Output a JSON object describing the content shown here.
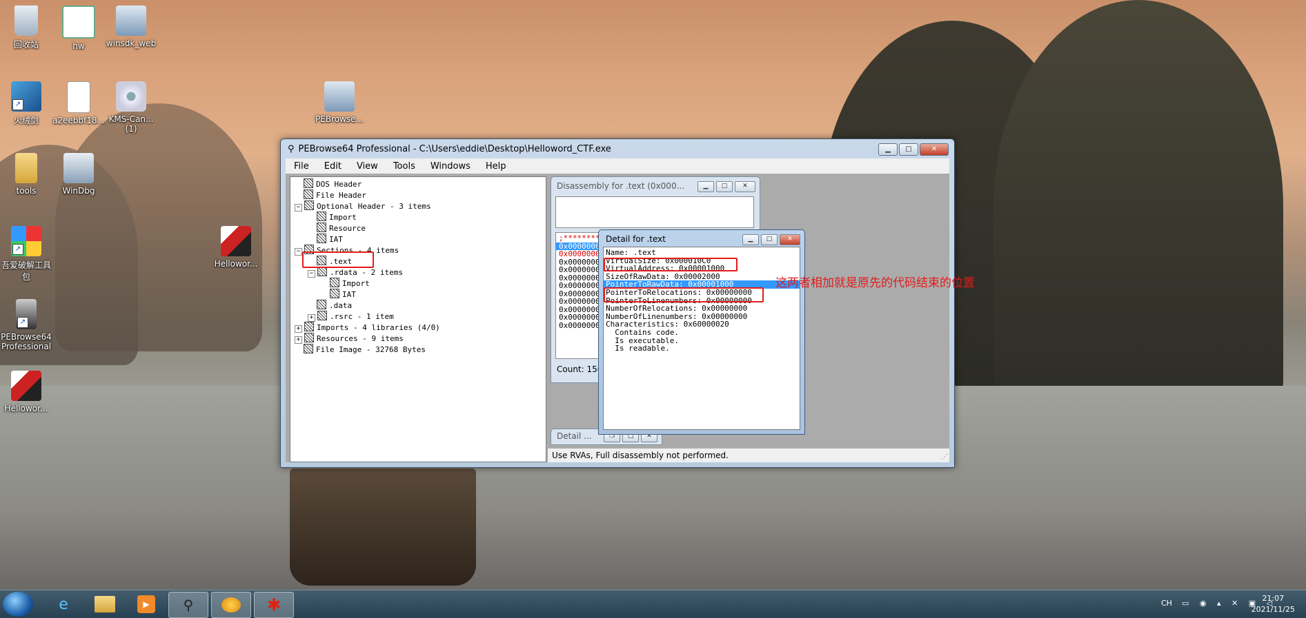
{
  "desktop": {
    "icons": [
      {
        "label": "回收站",
        "icon": "recycle-bin-icon"
      },
      {
        "label": "hw",
        "icon": "window-icon"
      },
      {
        "label": "winsdk_web",
        "icon": "installer-icon"
      },
      {
        "label": "火绒剑",
        "icon": "app-shortcut-icon"
      },
      {
        "label": "a2eebbf18...",
        "icon": "file-icon"
      },
      {
        "label": "KMS-Can... (1)",
        "icon": "gear-icon"
      },
      {
        "label": "PEBrowse...",
        "icon": "installer-icon"
      },
      {
        "label": "tools",
        "icon": "folder-icon"
      },
      {
        "label": "WinDbg",
        "icon": "debugger-icon"
      },
      {
        "label": "吾爱破解工具包",
        "icon": "toolkit-icon"
      },
      {
        "label": "Hellowor...",
        "icon": "cube-app-icon"
      },
      {
        "label": "PEBrowse64 Professional",
        "icon": "microscope-icon"
      },
      {
        "label": "Hellowor...",
        "icon": "cube-app-icon"
      }
    ]
  },
  "main_window": {
    "title": "PEBrowse64 Professional - C:\\Users\\eddie\\Desktop\\Helloword_CTF.exe",
    "menu": [
      "File",
      "Edit",
      "View",
      "Tools",
      "Windows",
      "Help"
    ],
    "tree": [
      {
        "label": "DOS Header",
        "level": 0,
        "expander": ""
      },
      {
        "label": "File Header",
        "level": 0,
        "expander": ""
      },
      {
        "label": "Optional Header - 3 items",
        "level": 0,
        "expander": "-"
      },
      {
        "label": "Import",
        "level": 1,
        "expander": ""
      },
      {
        "label": "Resource",
        "level": 1,
        "expander": ""
      },
      {
        "label": "IAT",
        "level": 1,
        "expander": ""
      },
      {
        "label": "Sections - 4 items",
        "level": 0,
        "expander": "-"
      },
      {
        "label": ".text",
        "level": 1,
        "expander": ""
      },
      {
        "label": ".rdata - 2 items",
        "level": 1,
        "expander": "-"
      },
      {
        "label": "Import",
        "level": 2,
        "expander": ""
      },
      {
        "label": "IAT",
        "level": 2,
        "expander": ""
      },
      {
        "label": ".data",
        "level": 1,
        "expander": ""
      },
      {
        "label": ".rsrc - 1 item",
        "level": 1,
        "expander": "+"
      },
      {
        "label": "Imports - 4 libraries (4/0)",
        "level": 0,
        "expander": "+"
      },
      {
        "label": "Resources - 9 items",
        "level": 0,
        "expander": "+"
      },
      {
        "label": "File Image - 32768 Bytes",
        "level": 0,
        "expander": ""
      }
    ],
    "status": "Use RVAs, Full disassembly not performed."
  },
  "disassembly_window": {
    "title": "Disassembly for .text (0x000...",
    "lines": [
      ";*********",
      "0x0000000",
      "0x0000000",
      "0x0000000",
      "0x0000000",
      "0x0000000",
      "0x0000000",
      "0x0000000",
      "0x0000000",
      "0x0000000",
      "0x0000000",
      "0x0000000"
    ],
    "count": "Count: 150"
  },
  "minimized_window": {
    "title": "Detail ..."
  },
  "detail_window": {
    "title": "Detail for .text",
    "lines": [
      "Name: .text",
      "VirtualSize: 0x000010C0",
      "VirtualAddress: 0x00001000",
      "SizeOfRawData: 0x00002000",
      "PointerToRawData: 0x00001000",
      "PointerToRelocations: 0x00000000",
      "PointerToLinenumbers: 0x00000000",
      "NumberOfRelocations: 0x00000000",
      "NumberOfLinenumbers: 0x00000000",
      "Characteristics: 0x60000020",
      "  Contains code.",
      "  Is executable.",
      "  Is readable."
    ],
    "selected_index": 4
  },
  "annotation": "这两者相加就是原先的代码结束的位置",
  "taskbar": {
    "items": [
      "ie-icon",
      "explorer-icon",
      "media-player-icon",
      "pebrowse-icon",
      "app-icon",
      "redstar-icon"
    ],
    "tray": {
      "lang": "CH",
      "time": "21:07",
      "date": "2021/11/25"
    }
  },
  "colors": {
    "annotation_red": "#e21b1b",
    "selection_blue": "#3399ff"
  }
}
